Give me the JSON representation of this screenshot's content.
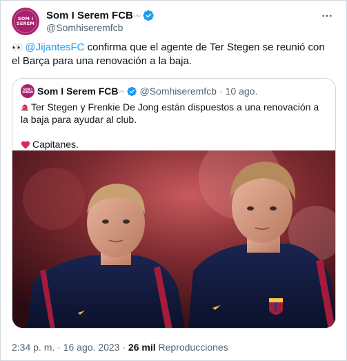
{
  "author": {
    "display_name": "Som I Serem FCB",
    "name_decoration": "〰",
    "handle": "@Somhiseremfcb",
    "avatar_text_line1": "SOM I",
    "avatar_text_line2": "SEREM",
    "avatar_color": "#a9216e"
  },
  "tweet": {
    "emoji": "👀",
    "mention": "@JijantesFC",
    "text": " confirma que el agente de Ter Stegen se reunió con el Barça para una renovación a la baja."
  },
  "quoted": {
    "display_name": "Som I Serem FCB",
    "name_decoration": "〰",
    "handle": "@Somhiseremfcb",
    "separator": "·",
    "time": "10 ago.",
    "line1": "Ter Stegen y Frenkie De Jong están dispuestos a una renovación a la baja para ayudar al club.",
    "line2": "Capitanes.",
    "photo_alt": "Ter Stegen y Frenkie De Jong con chaquetas azul marino del FC Barcelona"
  },
  "footer": {
    "time": "2:34 p. m.",
    "separator": "·",
    "date": "16 ago. 2023",
    "views_count": "26 mil",
    "views_label": "Reproducciones"
  },
  "colors": {
    "link": "#1d9bf0",
    "verified": "#1d9bf0",
    "secondary_text": "#536471",
    "border": "#cfd9de"
  },
  "icons": [
    "verified-badge-icon",
    "more-options-icon",
    "siren-icon",
    "heart-icon"
  ]
}
